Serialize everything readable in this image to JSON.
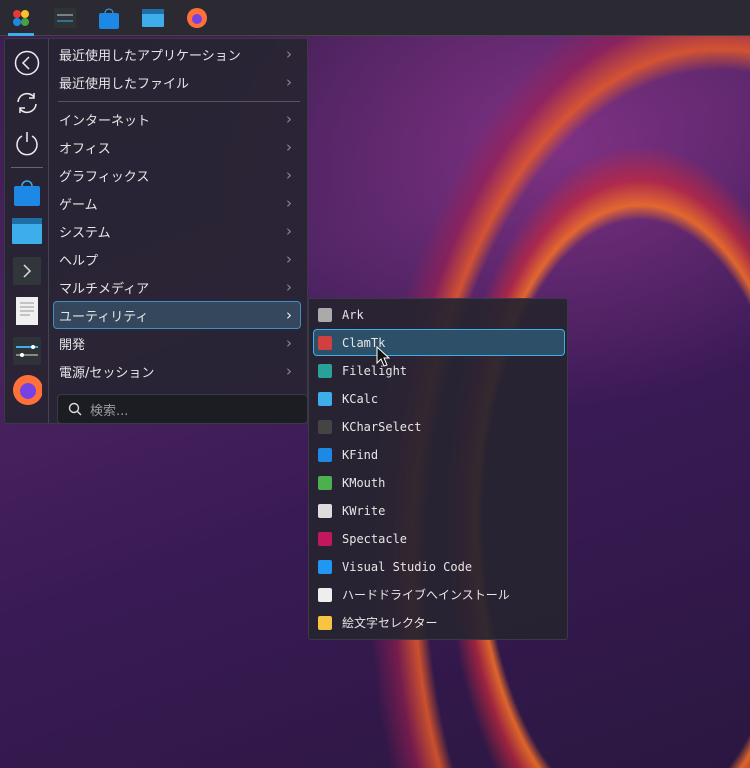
{
  "taskbar": {
    "items": [
      {
        "name": "app-launcher",
        "active": true
      },
      {
        "name": "system-settings"
      },
      {
        "name": "discover"
      },
      {
        "name": "dolphin"
      },
      {
        "name": "firefox"
      }
    ]
  },
  "sidebar": {
    "items": [
      "back-icon",
      "refresh-icon",
      "power-icon",
      "discover-icon",
      "folder-icon",
      "terminal-icon",
      "text-editor-icon",
      "settings-icon",
      "firefox-icon"
    ]
  },
  "menu": {
    "items": [
      {
        "label": "最近使用したアプリケーション"
      },
      {
        "label": "最近使用したファイル"
      },
      {
        "label": "インターネット"
      },
      {
        "label": "オフィス"
      },
      {
        "label": "グラフィックス"
      },
      {
        "label": "ゲーム"
      },
      {
        "label": "システム"
      },
      {
        "label": "ヘルプ"
      },
      {
        "label": "マルチメディア"
      },
      {
        "label": "ユーティリティ",
        "selected": true
      },
      {
        "label": "開発"
      },
      {
        "label": "電源/セッション"
      }
    ],
    "chevron": "›"
  },
  "search": {
    "placeholder": "検索..."
  },
  "submenu": {
    "items": [
      {
        "label": "Ark",
        "color": "#aaaaaa"
      },
      {
        "label": "ClamTk",
        "color": "#d04040",
        "selected": true
      },
      {
        "label": "Filelight",
        "color": "#2aa198"
      },
      {
        "label": "KCalc",
        "color": "#3daee9"
      },
      {
        "label": "KCharSelect",
        "color": "#444444"
      },
      {
        "label": "KFind",
        "color": "#1e88e5"
      },
      {
        "label": "KMouth",
        "color": "#4caf50"
      },
      {
        "label": "KWrite",
        "color": "#dddddd"
      },
      {
        "label": "Spectacle",
        "color": "#c2185b"
      },
      {
        "label": "Visual Studio Code",
        "color": "#2196f3"
      },
      {
        "label": "ハードドライブへインストール",
        "color": "#eeeeee"
      },
      {
        "label": "絵文字セレクター",
        "color": "#f6c342"
      }
    ]
  }
}
